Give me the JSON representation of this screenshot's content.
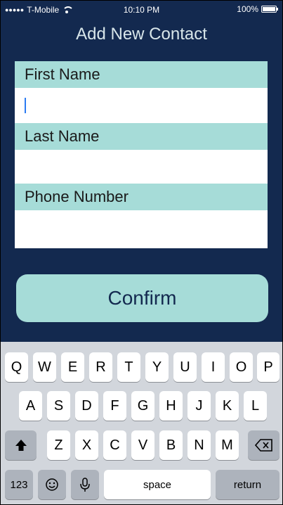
{
  "status": {
    "carrier": "T-Mobile",
    "time": "10:10 PM",
    "battery": "100%"
  },
  "title": "Add New Contact",
  "form": {
    "first_name_label": "First Name",
    "first_name_value": "",
    "last_name_label": "Last Name",
    "last_name_value": "",
    "phone_label": "Phone Number",
    "phone_value": ""
  },
  "confirm_label": "Confirm",
  "keyboard": {
    "row1": [
      "Q",
      "W",
      "E",
      "R",
      "T",
      "Y",
      "U",
      "I",
      "O",
      "P"
    ],
    "row2": [
      "A",
      "S",
      "D",
      "F",
      "G",
      "H",
      "J",
      "K",
      "L"
    ],
    "row3": [
      "Z",
      "X",
      "C",
      "V",
      "B",
      "N",
      "M"
    ],
    "numbers_label": "123",
    "space_label": "space",
    "return_label": "return",
    "shift_icon": "shift-icon",
    "delete_icon": "delete-icon",
    "emoji_icon": "emoji-icon",
    "mic_icon": "microphone-icon"
  }
}
